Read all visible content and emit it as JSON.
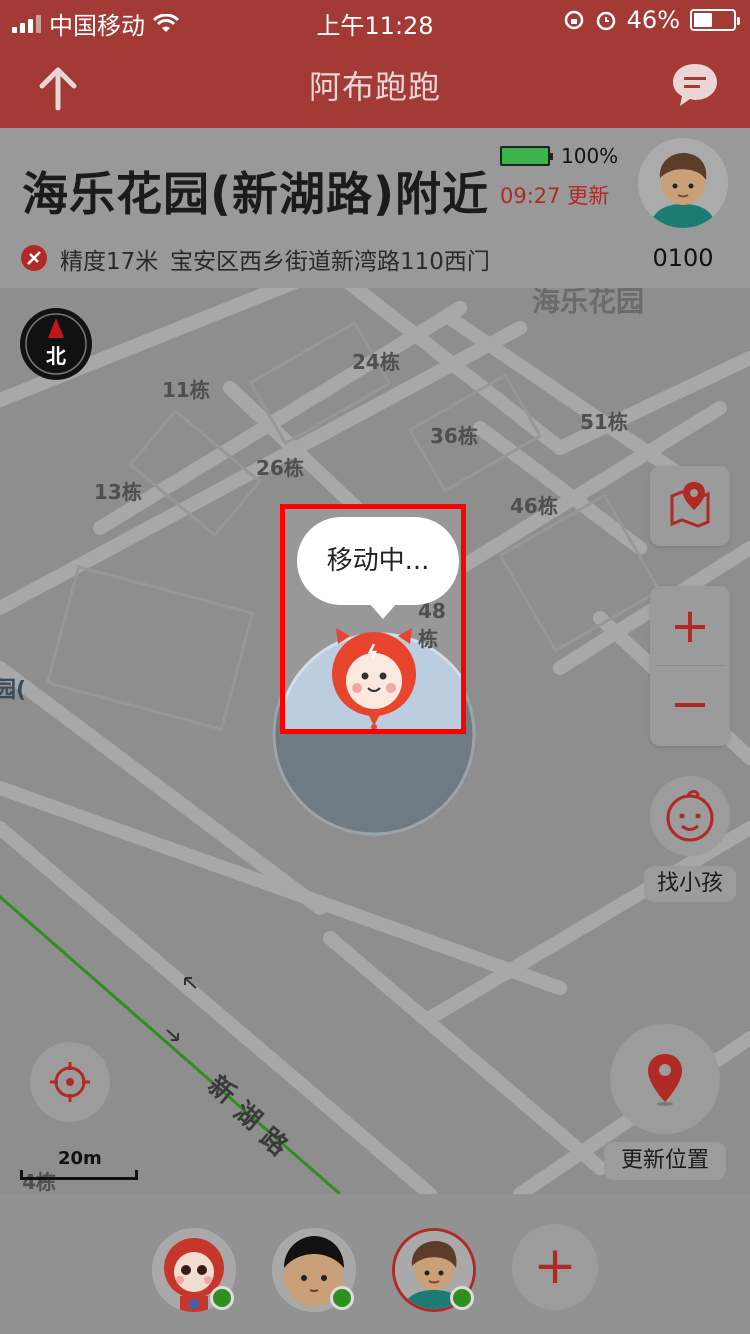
{
  "status_bar": {
    "carrier": "中国移动",
    "time": "上午11:28",
    "battery_percent": "46%"
  },
  "nav": {
    "title": "阿布跑跑",
    "back_icon": "up-arrow-icon",
    "message_icon": "chat-bubble-icon"
  },
  "info": {
    "place": "海乐花园(新湖路)附近",
    "device_battery": "100%",
    "device_battery_level": 1.0,
    "update_time": "09:27 更新",
    "accuracy": "精度17米",
    "address": "宝安区西乡街道新湾路110西门",
    "device_number": "0100"
  },
  "map": {
    "area_label": "海乐花园",
    "compass_label": "北",
    "buildings": [
      "24栋",
      "11栋",
      "36栋",
      "51栋",
      "26栋",
      "13栋",
      "46栋",
      "48栋",
      "4栋"
    ],
    "road_name": "新湖路",
    "road_chars": [
      "新",
      "湖",
      "路"
    ],
    "partial_edge_text": "园(",
    "scale": "20m",
    "marker_bubble": "移动中...",
    "find_child": "找小孩",
    "update_position": "更新位置",
    "zoom_in": "+",
    "zoom_out": "−"
  },
  "children": [
    {
      "name": "child-red-mascot",
      "online": true
    },
    {
      "name": "child-boy-black-hair",
      "online": true
    },
    {
      "name": "child-boy-brown-hair",
      "online": true,
      "selected": true
    }
  ],
  "add_child": "+",
  "colors": {
    "brand_red": "#a33a36",
    "online_green": "#2e8e1e",
    "highlight_red": "#ff0000"
  }
}
